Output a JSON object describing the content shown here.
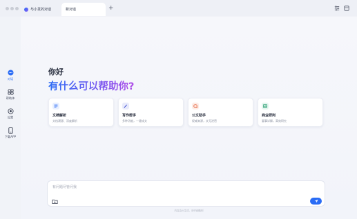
{
  "window": {
    "tabs": [
      {
        "label": "与小发的对话"
      },
      {
        "label": "新对话"
      }
    ],
    "new_tab_symbol": "+"
  },
  "sidebar": {
    "items": [
      {
        "label": "对话",
        "icon": "chat-bubble-icon",
        "active": true
      },
      {
        "label": "帮助体",
        "icon": "agents-icon",
        "active": false
      },
      {
        "label": "设置",
        "icon": "settings-icon",
        "active": false
      },
      {
        "label": "下载APP",
        "icon": "phone-download-icon",
        "active": false
      }
    ]
  },
  "main": {
    "greeting": "你好",
    "headline": "有什么可以帮助你?",
    "cards": [
      {
        "title": "文档解析",
        "desc": "文档溯源、深度解析",
        "icon": "document-icon",
        "icon_color": "#2a6cf5",
        "icon_bg": "#e8efff"
      },
      {
        "title": "写作帮手",
        "desc": "多种功能，一键成文",
        "icon": "pen-icon",
        "icon_color": "#3a4bd0",
        "icon_bg": "#e9ebfb"
      },
      {
        "title": "公文助手",
        "desc": "权威来源，文无泄密",
        "icon": "seal-icon",
        "icon_color": "#e2552c",
        "icon_bg": "#fdece6"
      },
      {
        "title": "商业研判",
        "desc": "要事详解，高效研究",
        "icon": "chart-icon",
        "icon_color": "#1f9a6b",
        "icon_bg": "#e3f5ee"
      }
    ],
    "input": {
      "placeholder": "有问题尽管问我"
    },
    "footnote": "内容由AI生成，请仔细甄别"
  },
  "colors": {
    "accent": "#2a6cf5",
    "headline_gradient_end": "#b04fe8"
  }
}
